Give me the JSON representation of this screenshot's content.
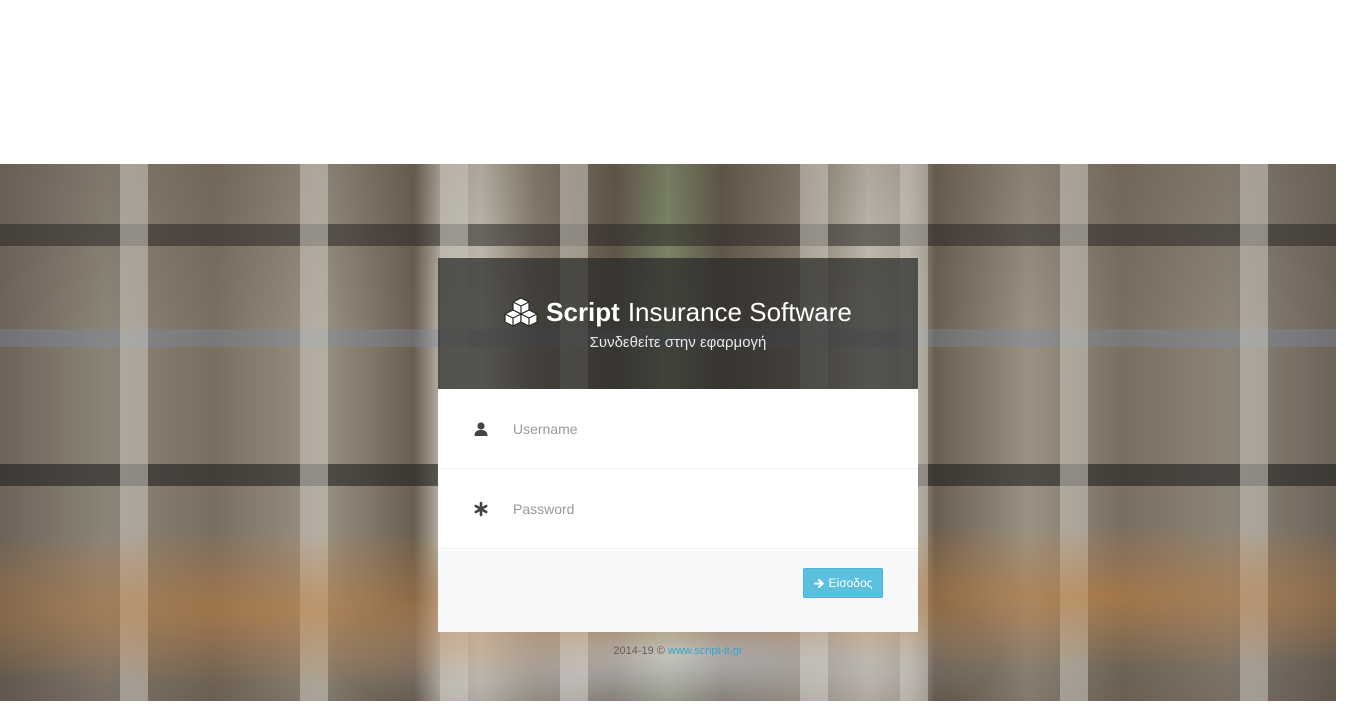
{
  "brand": {
    "name_strong": "Script",
    "name_rest": "Insurance Software",
    "icon": "cubes-icon"
  },
  "login": {
    "subtitle": "Συνδεθείτε στην εφαρμογή",
    "username_placeholder": "Username",
    "password_placeholder": "Password",
    "username_icon": "user-icon",
    "password_icon": "asterisk-icon",
    "submit_label": "Είσοδος",
    "submit_icon": "arrow-right-icon"
  },
  "footer": {
    "copyright": "2014-19 ©",
    "link_text": "www.script-it.gr"
  },
  "colors": {
    "accent": "#5bc0de",
    "header_overlay": "#282828",
    "footer_bg": "#f6f8fa",
    "link": "#31a6d4"
  }
}
